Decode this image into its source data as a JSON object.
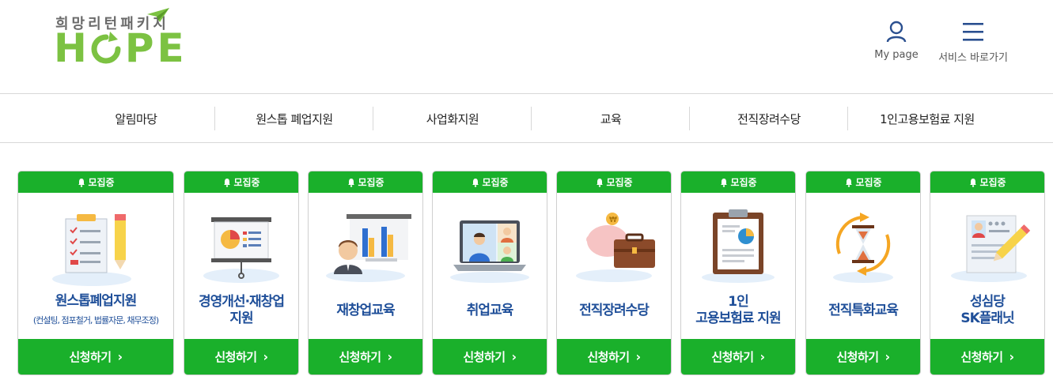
{
  "header": {
    "logo_sub": "희망리턴패키지",
    "logo_letters": [
      "H",
      "P",
      "E"
    ],
    "mypage_label": "My page",
    "sitemap_label": "서비스 바로가기"
  },
  "nav": {
    "items": [
      "알림마당",
      "원스톱 폐업지원",
      "사업화지원",
      "교육",
      "전직장려수당",
      "1인고용보험료 지원"
    ]
  },
  "colors": {
    "brand_green": "#1ab02b",
    "logo_green": "#7cc242",
    "title_blue": "#1f4f99"
  },
  "cards": [
    {
      "badge": "모집중",
      "title1": "원스톱폐업지원",
      "title2": "",
      "sub": "(컨설팅, 점포철거, 법률자문, 채무조정)",
      "button": "신청하기",
      "icon": "checklist-pencil-icon"
    },
    {
      "badge": "모집중",
      "title1": "경영개선·재창업",
      "title2": "지원",
      "sub": "",
      "button": "신청하기",
      "icon": "presentation-board-icon"
    },
    {
      "badge": "모집중",
      "title1": "재창업교육",
      "title2": "",
      "sub": "",
      "button": "신청하기",
      "icon": "lecturer-chart-icon"
    },
    {
      "badge": "모집중",
      "title1": "취업교육",
      "title2": "",
      "sub": "",
      "button": "신청하기",
      "icon": "video-meeting-laptop-icon"
    },
    {
      "badge": "모집중",
      "title1": "전직장려수당",
      "title2": "",
      "sub": "",
      "button": "신청하기",
      "icon": "piggybank-briefcase-icon"
    },
    {
      "badge": "모집중",
      "title1": "1인",
      "title2": "고용보험료 지원",
      "sub": "",
      "button": "신청하기",
      "icon": "clipboard-report-icon"
    },
    {
      "badge": "모집중",
      "title1": "전직특화교육",
      "title2": "",
      "sub": "",
      "button": "신청하기",
      "icon": "hourglass-cycle-icon"
    },
    {
      "badge": "모집중",
      "title1": "성심당",
      "title2": "SK플래닛",
      "sub": "",
      "button": "신청하기",
      "icon": "resume-pencil-icon"
    }
  ]
}
